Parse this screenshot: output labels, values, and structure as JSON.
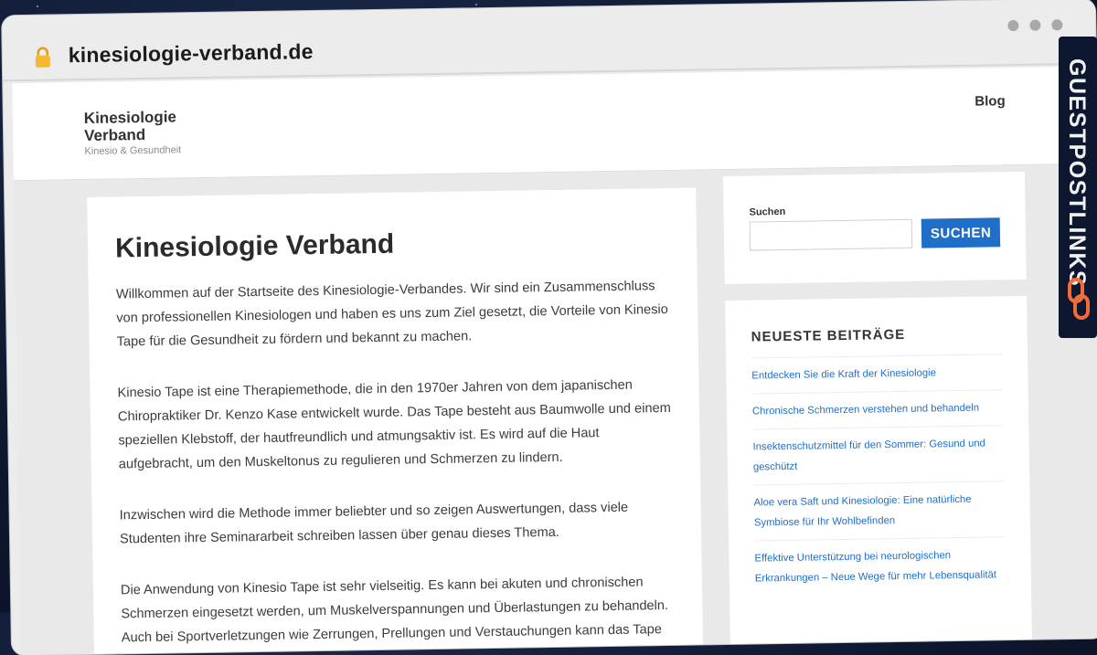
{
  "browser": {
    "url": "kinesiologie-verband.de",
    "lock_icon": "lock-icon"
  },
  "site": {
    "title": "Kinesiologie Verband",
    "tagline": "Kinesio & Gesundheit",
    "nav": {
      "blog": "Blog"
    }
  },
  "main": {
    "heading": "Kinesiologie Verband",
    "paragraphs": [
      "Willkommen auf der Startseite des Kinesiologie-Verbandes. Wir sind ein Zusammenschluss von professionellen Kinesiologen und haben es uns zum Ziel gesetzt, die Vorteile von Kinesio Tape für die Gesundheit zu fördern und bekannt zu machen.",
      "Kinesio Tape ist eine Therapiemethode, die in den 1970er Jahren von dem japanischen Chiropraktiker Dr. Kenzo Kase entwickelt wurde. Das Tape besteht aus Baumwolle und einem speziellen Klebstoff, der hautfreundlich und atmungsaktiv ist. Es wird auf die Haut aufgebracht, um den Muskeltonus zu regulieren und Schmerzen zu lindern.",
      "Inzwischen wird die Methode immer beliebter und so zeigen Auswertungen, dass viele Studenten ihre Seminararbeit schreiben lassen über genau dieses Thema.",
      "Die Anwendung von Kinesio Tape ist sehr vielseitig. Es kann bei akuten und chronischen Schmerzen eingesetzt werden, um Muskelverspannungen und Überlastungen zu behandeln. Auch bei Sportverletzungen wie Zerrungen, Prellungen und Verstauchungen kann das Tape"
    ]
  },
  "sidebar": {
    "search": {
      "label": "Suchen",
      "value": "",
      "placeholder": "",
      "button": "SUCHEN"
    },
    "recent": {
      "title": "NEUESTE BEITRÄGE",
      "items": [
        "Entdecken Sie die Kraft der Kinesiologie",
        "Chronische Schmerzen verstehen und behandeln",
        "Insektenschutzmittel für den Sommer: Gesund und geschützt",
        "Aloe vera Saft und Kinesiologie: Eine natürliche Symbiose für Ihr Wohlbefinden",
        "Effektive Unterstützung bei neurologischen Erkrankungen – Neue Wege für mehr Lebensqualität"
      ]
    }
  },
  "brand": {
    "text": "GUESTPOSTLINKS",
    "logo_icon": "chain-link-icon",
    "accent": "#f26b3a"
  },
  "colors": {
    "link": "#1f6fc9",
    "button": "#1f6fc9"
  }
}
